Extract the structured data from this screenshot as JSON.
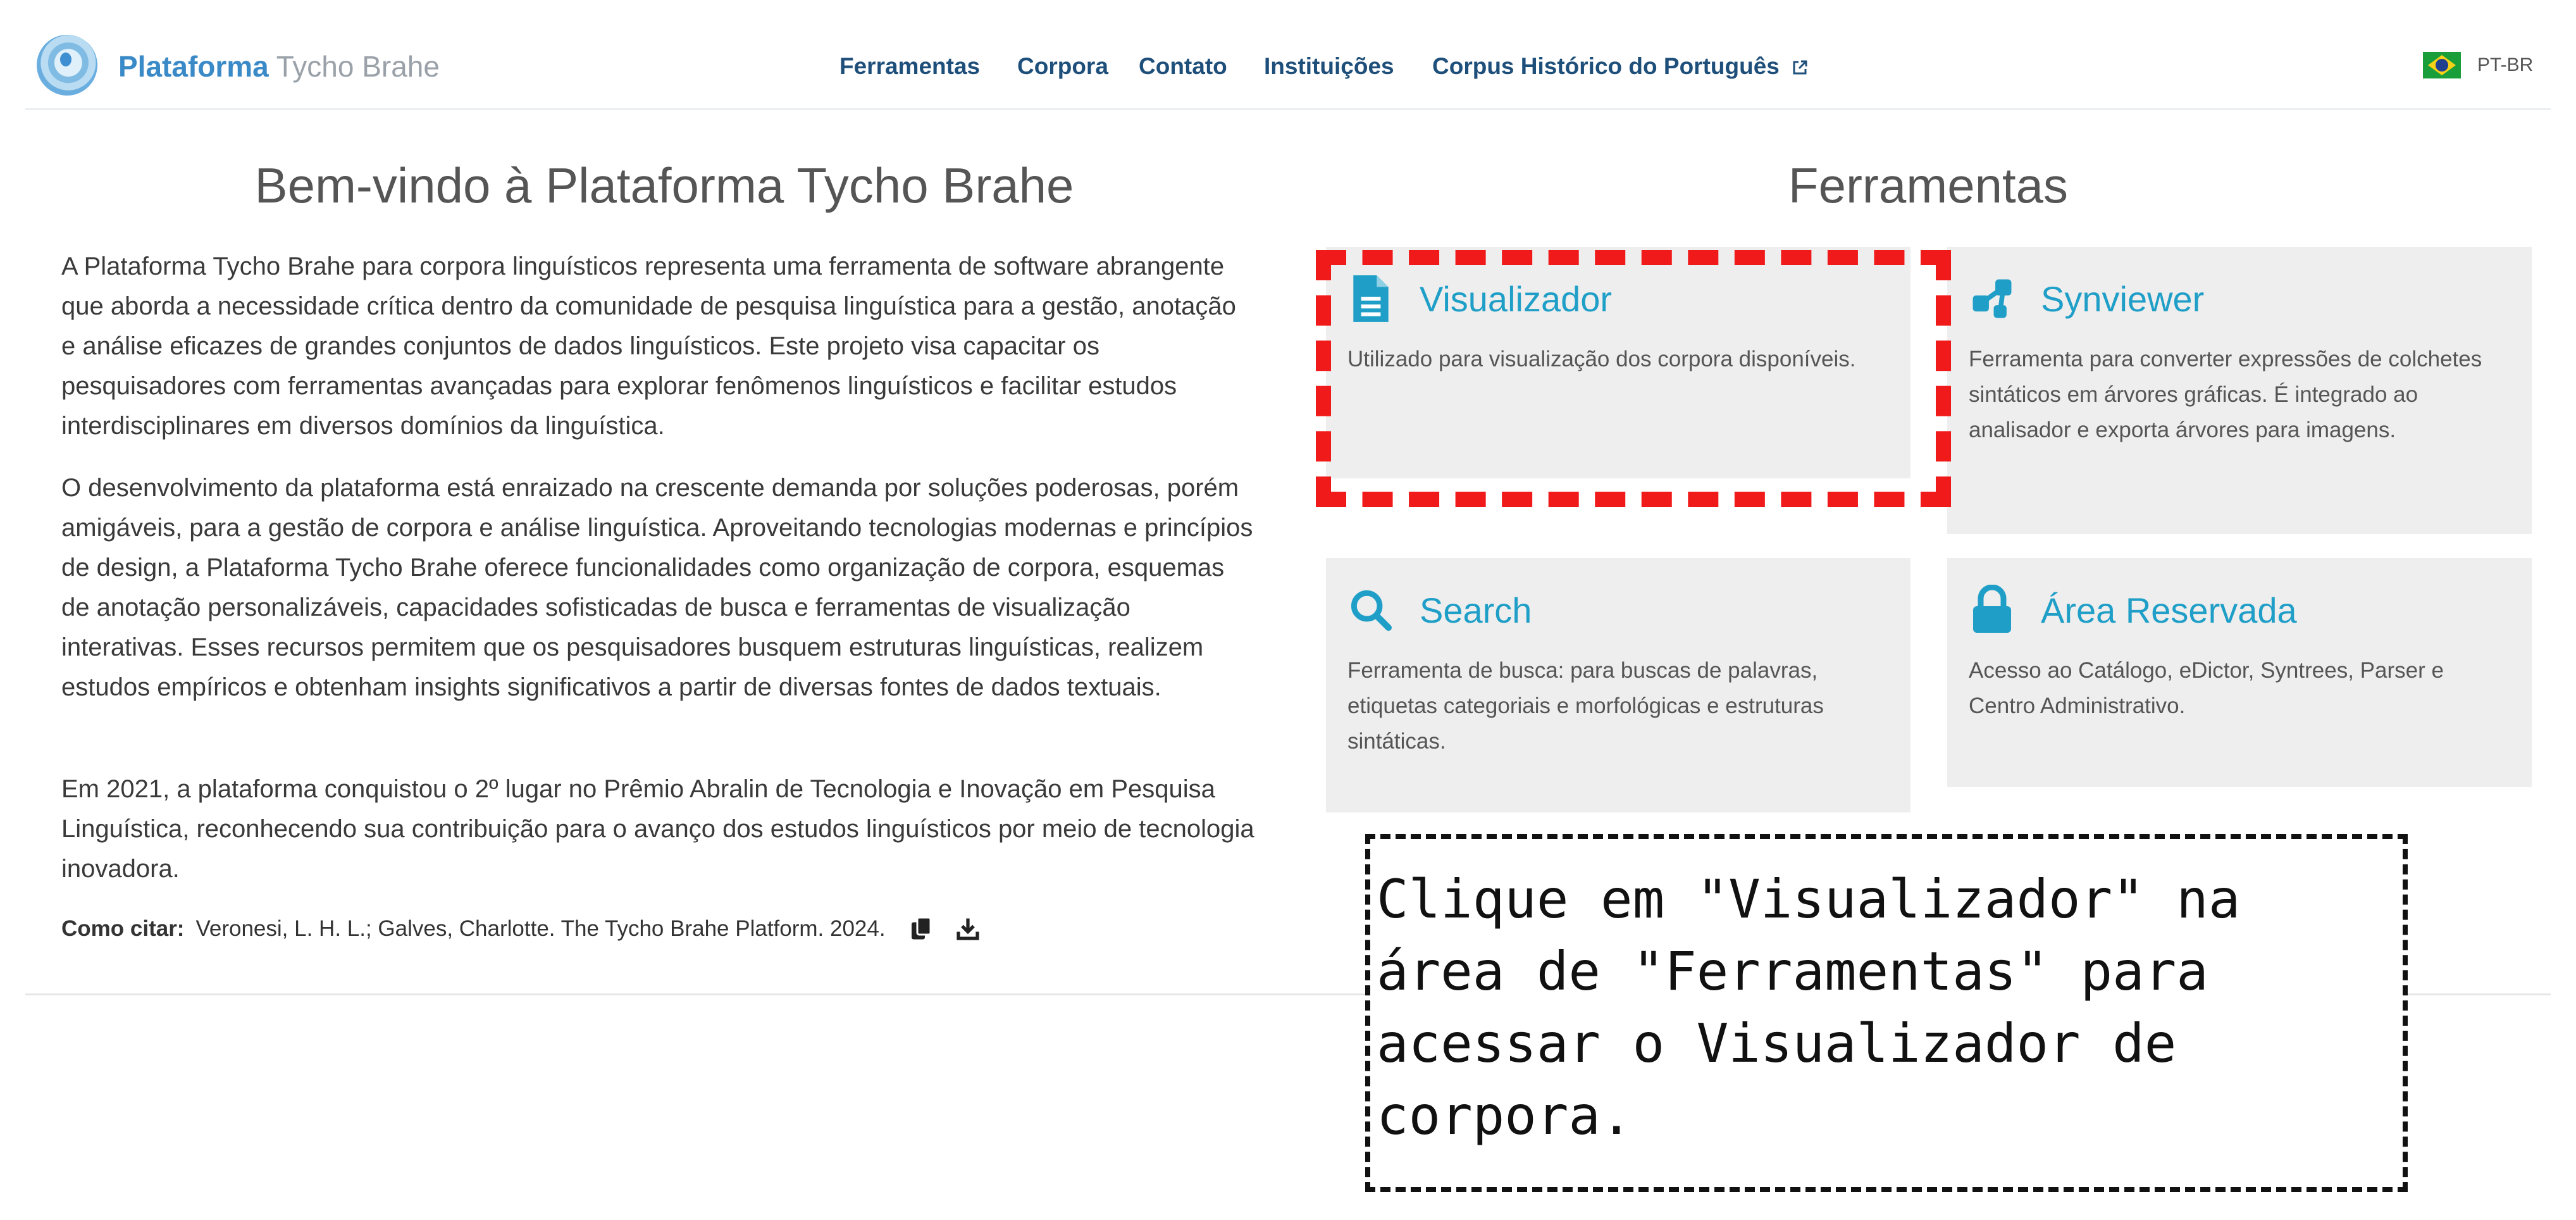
{
  "header": {
    "brand_primary": "Plataforma",
    "brand_secondary": "Tycho Brahe",
    "nav": [
      "Ferramentas",
      "Corpora",
      "Contato",
      "Instituições",
      "Corpus Histórico do Português"
    ],
    "language": "PT-BR"
  },
  "welcome": {
    "title": "Bem-vindo à Plataforma Tycho Brahe",
    "paragraphs": [
      "A Plataforma Tycho Brahe para corpora linguísticos representa uma ferramenta de software abrangente que aborda a necessidade crítica dentro da comunidade de pesquisa linguística para a gestão, anotação e análise eficazes de grandes conjuntos de dados linguísticos. Este projeto visa capacitar os pesquisadores com ferramentas avançadas para explorar fenômenos linguísticos e facilitar estudos interdisciplinares em diversos domínios da linguística.",
      "O desenvolvimento da plataforma está enraizado na crescente demanda por soluções poderosas, porém amigáveis, para a gestão de corpora e análise linguística. Aproveitando tecnologias modernas e princípios de design, a Plataforma Tycho Brahe oferece funcionalidades como organização de corpora, esquemas de anotação personalizáveis, capacidades sofisticadas de busca e ferramentas de visualização interativas. Esses recursos permitem que os pesquisadores busquem estruturas linguísticas, realizem estudos empíricos e obtenham insights significativos a partir de diversas fontes de dados textuais.",
      "Em 2021, a plataforma conquistou o 2º lugar no Prêmio Abralin de Tecnologia e Inovação em Pesquisa Linguística, reconhecendo sua contribuição para o avanço dos estudos linguísticos por meio de tecnologia inovadora."
    ],
    "cite_label": "Como citar:",
    "cite_text": "Veronesi, L. H. L.; Galves, Charlotte. The Tycho Brahe Platform. 2024."
  },
  "tools": {
    "title": "Ferramentas",
    "cards": [
      {
        "title": "Visualizador",
        "icon": "document-icon",
        "description": "Utilizado para visualização dos corpora disponíveis."
      },
      {
        "title": "Synviewer",
        "icon": "tree-icon",
        "description": "Ferramenta para converter expressões de colchetes sintáticos em árvores gráficas. É integrado ao analisador e exporta árvores para imagens."
      },
      {
        "title": "Search",
        "icon": "search-icon",
        "description": "Ferramenta de busca: para buscas de palavras, etiquetas categoriais e morfológicas e estruturas sintáticas."
      },
      {
        "title": "Área Reservada",
        "icon": "lock-icon",
        "description": "Acesso ao Catálogo, eDictor, Syntrees, Parser e Centro Administrativo."
      }
    ]
  },
  "instruction": "Clique em \"Visualizador\" na área de \"Ferramentas\" para acessar o Visualizador de corpora.",
  "colors": {
    "accent": "#1f9fc7",
    "nav": "#1e4f7a",
    "highlight": "#f01a1a",
    "card_bg": "#eeeeee"
  }
}
